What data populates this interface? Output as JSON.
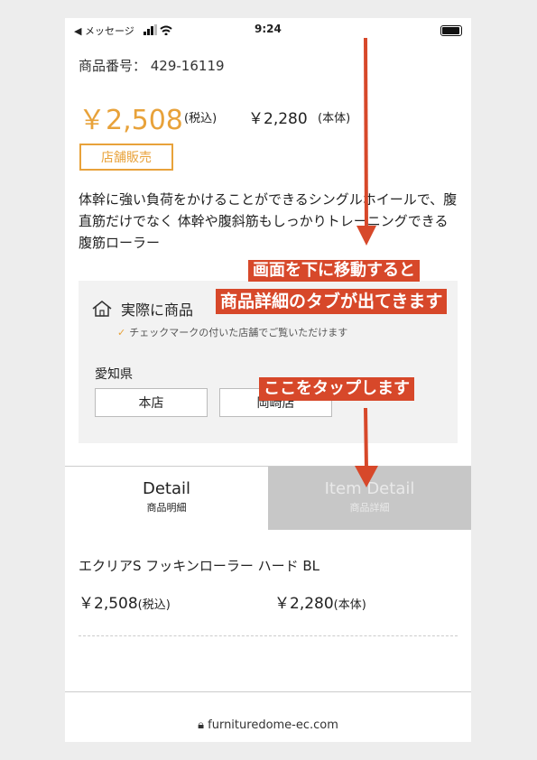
{
  "status_bar": {
    "back_label": "◀ メッセージ",
    "time": "9:24"
  },
  "product": {
    "code": "商品番号： 429-16119",
    "price_taxin": "￥2,508",
    "price_taxin_tag": "(税込)",
    "price_base": "￥2,280",
    "price_base_tag": "(本体)",
    "store_badge": "店舗販売",
    "description": "体幹に強い負荷をかけることができるシングルホイールで、腹直筋だけでなく 体幹や腹斜筋もしっかりトレーニングできる腹筋ローラー"
  },
  "stock": {
    "title": "実際に商品",
    "note": "チェックマークの付いた店舗でご覧いただけます",
    "prefecture": "愛知県",
    "stores": [
      "本店",
      "岡崎店"
    ]
  },
  "tabs": [
    {
      "en": "Detail",
      "ja": "商品明細"
    },
    {
      "en": "Item Detail",
      "ja": "商品詳細"
    }
  ],
  "detail": {
    "name": "エクリアS フッキンローラー ハード BL",
    "price_taxin": "￥2,508",
    "price_taxin_tag": "(税込)",
    "price_base": "￥2,280",
    "price_base_tag": "(本体)"
  },
  "url": "furnituredome-ec.com",
  "annotations": {
    "line1": "画面を下に移動すると",
    "line2": "商品詳細のタブが出てきます",
    "tap": "ここをタップします"
  },
  "colors": {
    "accent": "#e8a23a",
    "annotation": "#d7482a",
    "inactive_tab": "#c7c7c7"
  }
}
